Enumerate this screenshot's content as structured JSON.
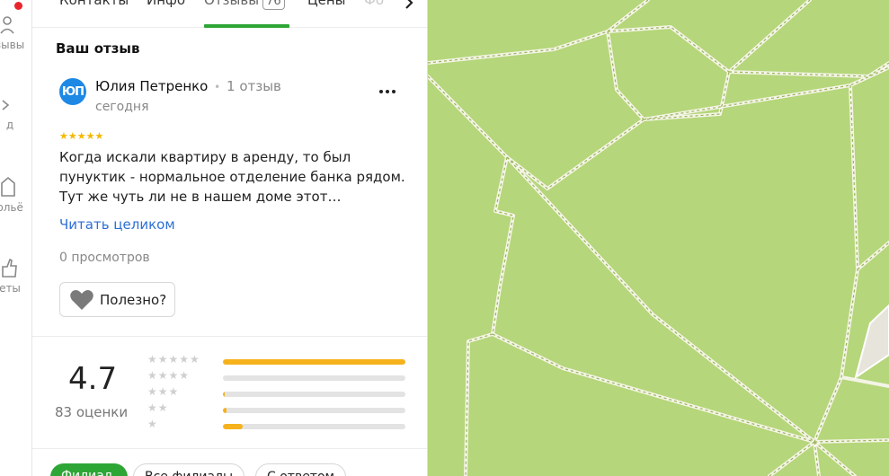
{
  "rail": {
    "items": [
      {
        "label": "зывы",
        "icon": "person-icon"
      },
      {
        "label": "д",
        "icon": "shoe-icon"
      },
      {
        "label": "рльё",
        "icon": "building-icon"
      },
      {
        "label": "еты",
        "icon": "thumb-icon"
      }
    ]
  },
  "tabs": {
    "contacts": "Контакты",
    "info": "Инфо",
    "reviews": "Отзывы",
    "reviews_count": "76",
    "prices": "Цены",
    "photo": "Фо"
  },
  "review": {
    "section_title": "Ваш отзыв",
    "avatar_initials": "ЮП",
    "author": "Юлия Петренко",
    "author_separator": "•",
    "author_reviews": "1 отзыв",
    "date": "сегодня",
    "stars": "★★★★★",
    "text": "Когда искали квартиру в аренду, то был пунуктик - нормальное отделение банка рядом. Тут же чуть ли не в нашем доме этот…",
    "read_more": "Читать целиком",
    "views": "0 просмотров",
    "useful_label": "Полезно?"
  },
  "rating": {
    "value": "4.7",
    "count_label": "83 оценки",
    "distribution": [
      {
        "stars": "★★★★★",
        "fraction": 1.0
      },
      {
        "stars": "★★★★",
        "fraction": 0.0
      },
      {
        "stars": "★★★",
        "fraction": 0.01
      },
      {
        "stars": "★★",
        "fraction": 0.02
      },
      {
        "stars": "★",
        "fraction": 0.11
      }
    ]
  },
  "filters": {
    "first": "Филиал",
    "second": "Все филиалы",
    "third": "С ответом"
  },
  "colors": {
    "accent_green": "#2da636",
    "link_blue": "#2d6fd6",
    "star_yellow": "#f5b800",
    "map_green": "#b5d67a"
  }
}
